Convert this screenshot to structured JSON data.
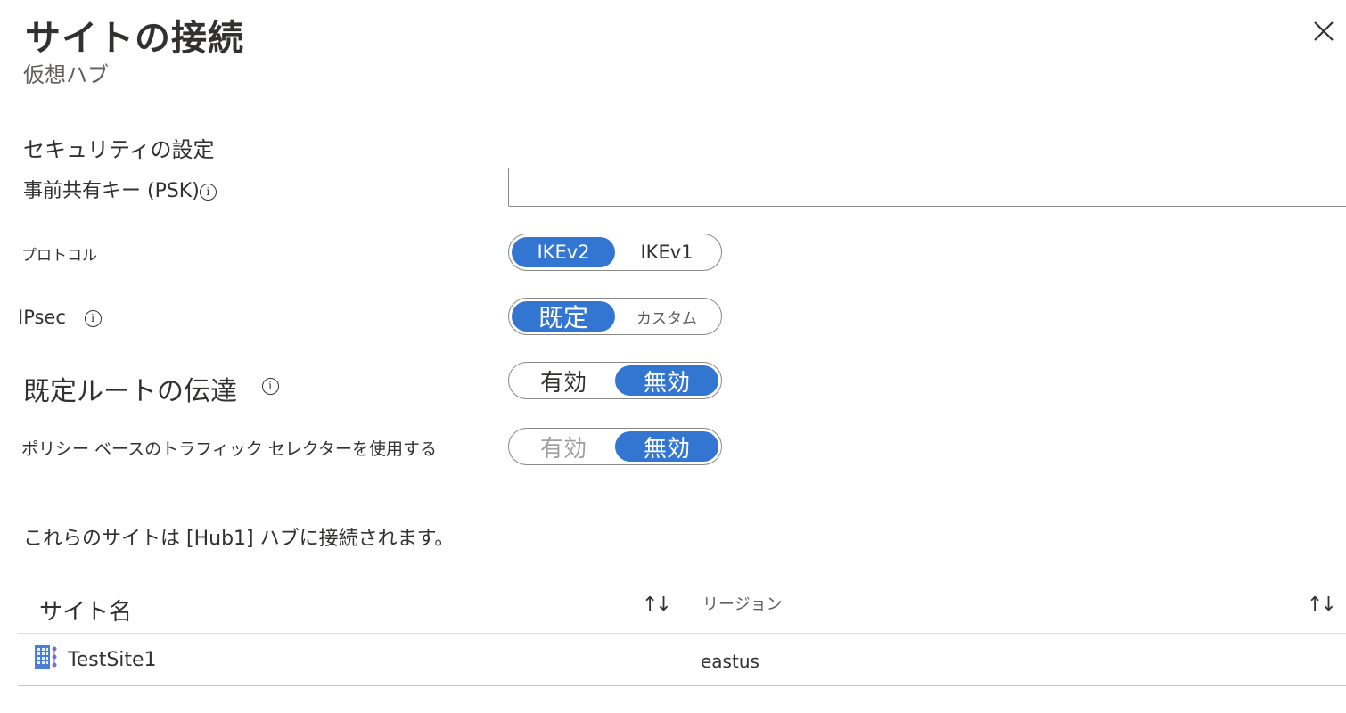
{
  "header": {
    "title": "サイトの接続",
    "subtitle": "仮想ハブ"
  },
  "security": {
    "section_title": "セキュリティの設定",
    "psk_label": "事前共有キー (PSK)",
    "psk_value": "",
    "protocol_label": "プロトコル",
    "protocol_options": [
      "IKEv2",
      "IKEv1"
    ],
    "protocol_selected": "IKEv2",
    "ipsec_label": "IPsec",
    "ipsec_options": [
      "既定",
      "カスタム"
    ],
    "ipsec_selected": "既定",
    "route_label": "既定ルートの伝達",
    "route_options": [
      "有効",
      "無効"
    ],
    "route_selected": "無効",
    "policy_label": "ポリシー ベースのトラフィック セレクターを使用する",
    "policy_options": [
      "有効",
      "無効"
    ],
    "policy_selected": "無効"
  },
  "info_text": "これらのサイトは [Hub1] ハブに接続されます。",
  "table": {
    "columns": [
      "サイト名",
      "リージョン"
    ],
    "sort_glyph": "↑↓",
    "rows": [
      {
        "name": "TestSite1",
        "region": "eastus"
      }
    ]
  },
  "icons": {
    "info": "i",
    "close": "close-icon",
    "site": "building-icon"
  },
  "colors": {
    "accent": "#3376d2",
    "text": "#323130",
    "muted": "#605e5c"
  }
}
